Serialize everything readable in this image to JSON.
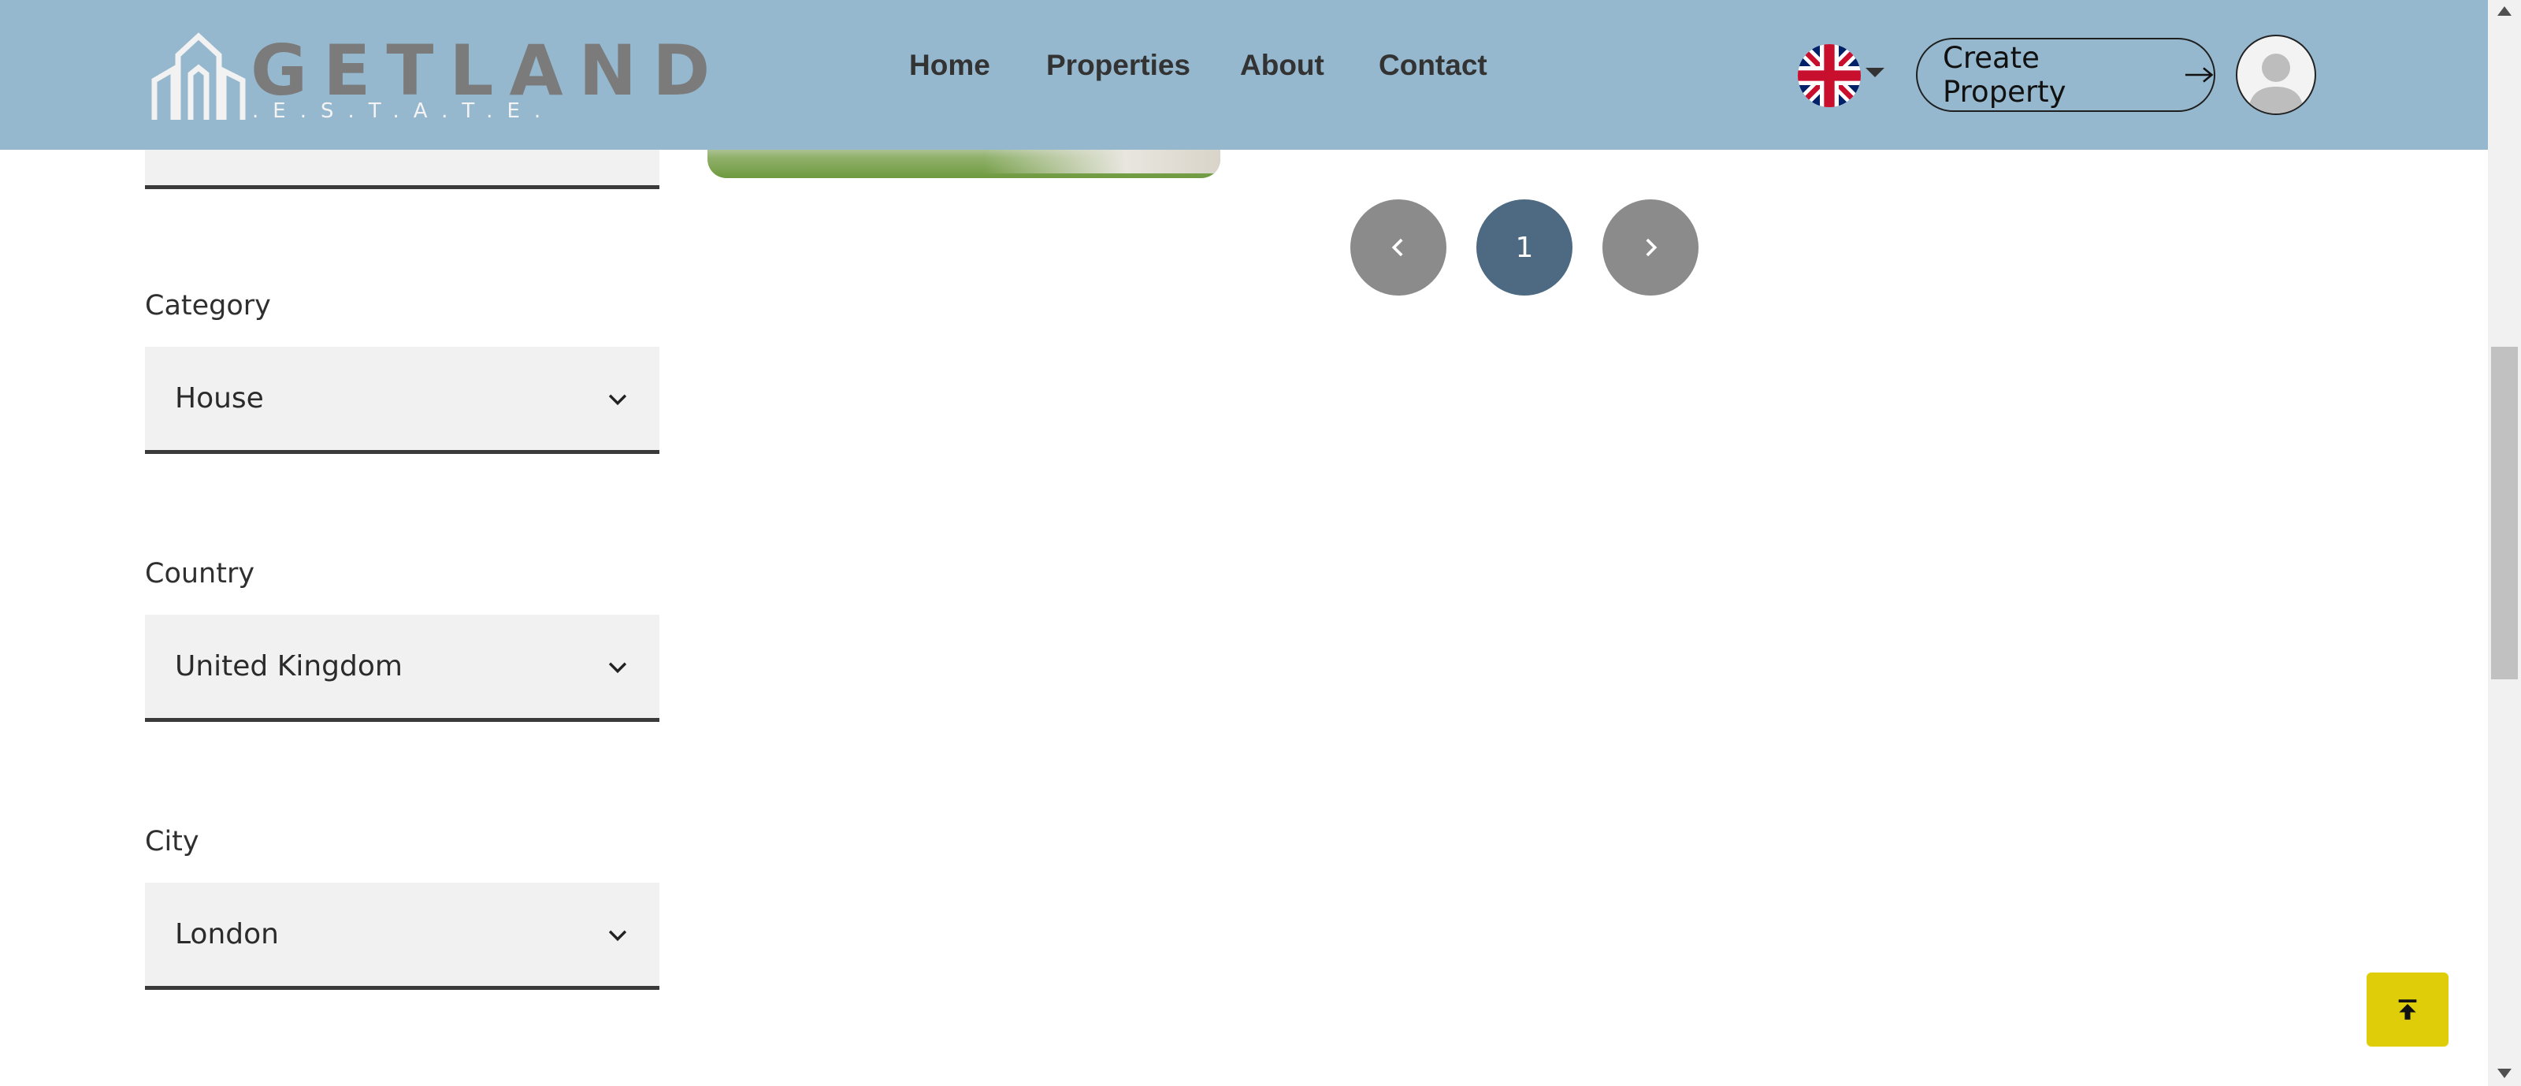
{
  "brand": {
    "name": "GETLAND",
    "tagline": ".E.S.T.A.T.E."
  },
  "nav": {
    "links": [
      "Home",
      "Properties",
      "About",
      "Contact"
    ]
  },
  "header": {
    "language": "English (UK)",
    "create_label": "Create Property"
  },
  "filters": {
    "category": {
      "label": "Category",
      "value": "House"
    },
    "country": {
      "label": "Country",
      "value": "United Kingdom"
    },
    "city": {
      "label": "City",
      "value": "London"
    }
  },
  "pagination": {
    "current": "1"
  },
  "colors": {
    "header_bg": "#95b8ce",
    "pagination_active": "#4d6a82",
    "pagination_nav": "#8b8b8b",
    "back_to_top": "#e0cd0a"
  },
  "icons": [
    "uk-flag-icon",
    "caret-down-icon",
    "arrow-right-icon",
    "user-avatar-icon",
    "chevron-down-icon",
    "chevron-left-icon",
    "chevron-right-icon",
    "back-to-top-icon"
  ]
}
